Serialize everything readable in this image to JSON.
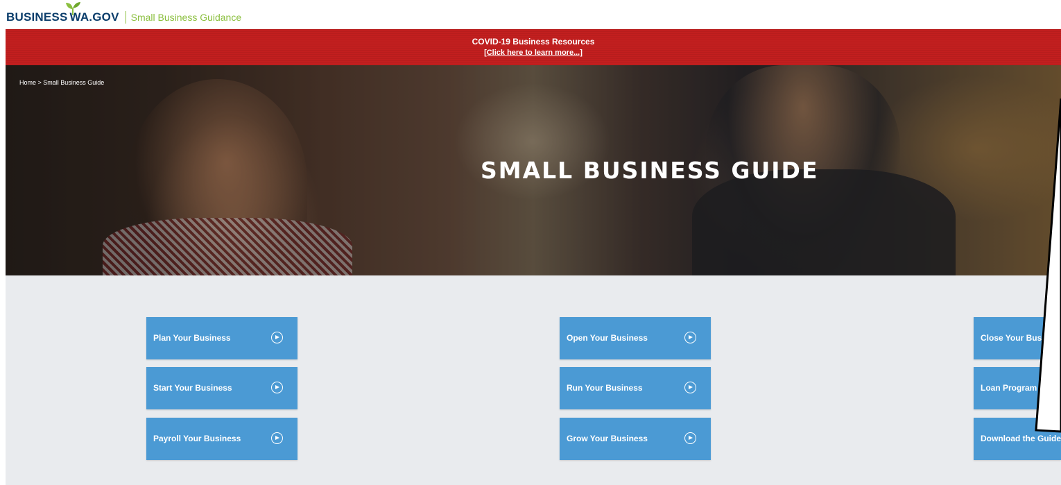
{
  "header": {
    "logo_text_left": "BUSINESS",
    "logo_text_right": "WA.GOV",
    "tagline": "Small Business Guidance"
  },
  "covid_banner": {
    "title": "COVID-19 Business Resources",
    "link": "[Click here to learn more...]"
  },
  "hero": {
    "breadcrumb": "Home > Small Business Guide",
    "title": "SMALL BUSINESS GUIDE"
  },
  "guide_buttons": [
    {
      "label": "Plan Your Business",
      "icon": "play-circle-icon"
    },
    {
      "label": "Start Your Business",
      "icon": "play-circle-icon"
    },
    {
      "label": "Payroll Your Business",
      "icon": "play-circle-icon"
    },
    {
      "label": "Open Your Business",
      "icon": "play-circle-icon"
    },
    {
      "label": "Run Your Business",
      "icon": "play-circle-icon"
    },
    {
      "label": "Grow Your Business",
      "icon": "play-circle-icon"
    },
    {
      "label": "Close Your Bus",
      "icon": "play-circle-icon"
    },
    {
      "label": "Loan Program",
      "icon": "play-circle-icon"
    },
    {
      "label": "Download the Guide",
      "icon": "play-circle-icon"
    }
  ],
  "colors": {
    "brand_navy": "#0b3d6b",
    "brand_green": "#8bbf3f",
    "banner_red": "#c21f1f",
    "button_blue": "#4b9ad4",
    "guide_bg": "#e9ebee"
  }
}
